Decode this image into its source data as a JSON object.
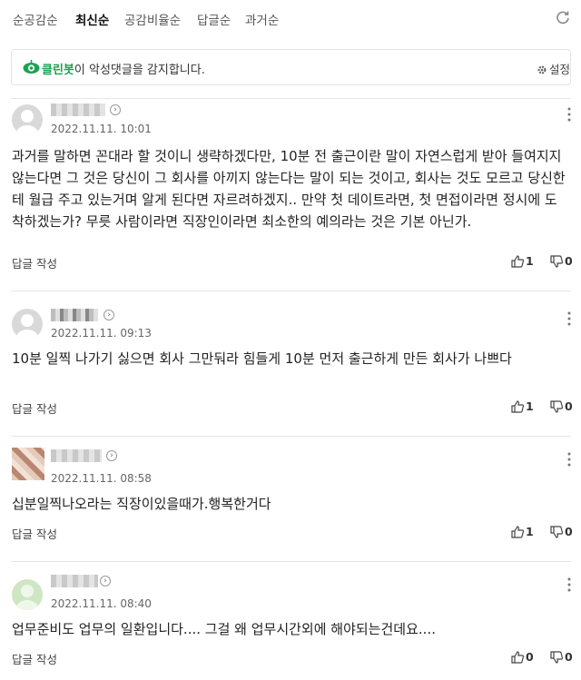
{
  "sort_tabs": [
    {
      "label": "순공감순",
      "active": false
    },
    {
      "label": "최신순",
      "active": true
    },
    {
      "label": "공감비율순",
      "active": false
    },
    {
      "label": "답글순",
      "active": false
    },
    {
      "label": "과거순",
      "active": false
    }
  ],
  "cleanbot": {
    "brand": "클린봇",
    "message": "이 악성댓글을 감지합니다.",
    "settings_label": "설정",
    "brand_color": "#1aa251"
  },
  "comments": [
    {
      "date": "2022.11.11. 10:01",
      "text": "과거를 말하면 꼰대라 할 것이니 생략하겠다만, 10분 전 출근이란 말이 자연스럽게 받아 들여지지 않는다면 그 것은 당신이 그 회사를 아끼지 않는다는 말이 되는 것이고, 회사는 것도 모르고 당신한테 월급 주고 있는거며 알게 된다면 자르려하겠지.. 만약 첫 데이트라면, 첫 면접이라면 정시에 도착하겠는가? 무릇 사람이라면 직장인이라면 최소한의 예의라는 것은 기본 아닌가.",
      "reply_label": "답글 작성",
      "likes": "1",
      "dislikes": "0"
    },
    {
      "date": "2022.11.11. 09:13",
      "text": "10분 일찍 나가기 싫으면 회사 그만둬라 힘들게 10분 먼저 출근하게 만든 회사가 나쁘다",
      "reply_label": "답글 작성",
      "likes": "1",
      "dislikes": "0"
    },
    {
      "date": "2022.11.11. 08:58",
      "text": "십분일찍나오라는 직장이있을때가.행복한거다",
      "reply_label": "답글 작성",
      "likes": "1",
      "dislikes": "0"
    },
    {
      "date": "2022.11.11. 08:40",
      "text": "업무준비도 업무의 일환입니다.... 그걸 왜 업무시간외에 해야되는건데요....",
      "reply_label": "답글 작성",
      "likes": "0",
      "dislikes": "0"
    }
  ]
}
